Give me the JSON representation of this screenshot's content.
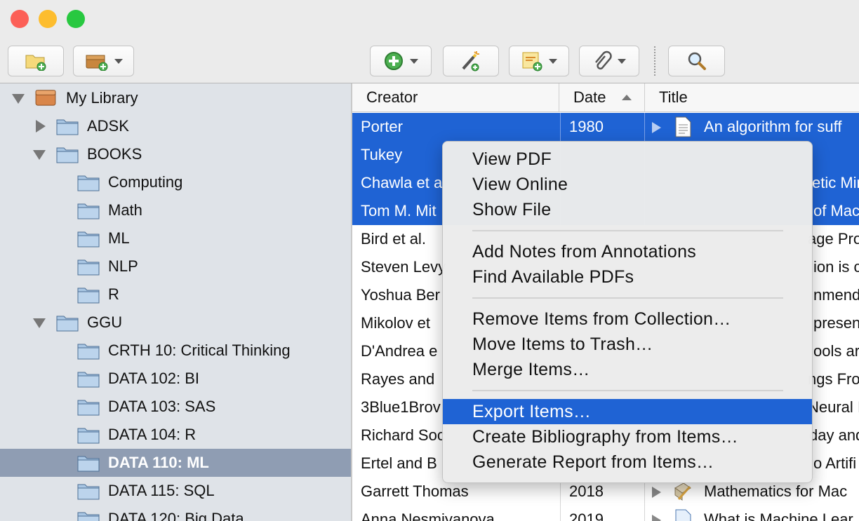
{
  "window": {
    "traffic_lights": {
      "close": "#fc5f57",
      "minimize": "#fdbd2e",
      "zoom": "#28c840"
    }
  },
  "toolbar": {
    "buttons": [
      {
        "icon": "new-collection-icon"
      },
      {
        "icon": "new-library-icon",
        "has_menu": true
      },
      {
        "icon": "new-item-icon",
        "has_menu": true
      },
      {
        "icon": "add-by-identifier-icon"
      },
      {
        "icon": "new-note-icon",
        "has_menu": true
      },
      {
        "icon": "add-attachment-icon",
        "has_menu": true
      },
      {
        "icon": "search-icon"
      }
    ]
  },
  "sidebar": {
    "items": [
      {
        "label": "My Library",
        "level": 0,
        "expanded": true,
        "type": "library"
      },
      {
        "label": "ADSK",
        "level": 1,
        "expanded": false
      },
      {
        "label": "BOOKS",
        "level": 1,
        "expanded": true
      },
      {
        "label": "Computing",
        "level": 2
      },
      {
        "label": "Math",
        "level": 2
      },
      {
        "label": "ML",
        "level": 2
      },
      {
        "label": "NLP",
        "level": 2
      },
      {
        "label": "R",
        "level": 2
      },
      {
        "label": "GGU",
        "level": 1,
        "expanded": true
      },
      {
        "label": "CRTH 10: Critical Thinking",
        "level": 2
      },
      {
        "label": "DATA 102: BI",
        "level": 2
      },
      {
        "label": "DATA 103: SAS",
        "level": 2
      },
      {
        "label": "DATA 104: R",
        "level": 2
      },
      {
        "label": "DATA 110: ML",
        "level": 2,
        "selected": true
      },
      {
        "label": "DATA 115: SQL",
        "level": 2
      },
      {
        "label": "DATA 120: Big Data",
        "level": 2
      }
    ]
  },
  "table": {
    "columns": {
      "creator": "Creator",
      "date": "Date",
      "title": "Title"
    },
    "sort": {
      "column": "date",
      "direction": "ascending"
    },
    "rows": [
      {
        "creator": "Porter",
        "date": "1980",
        "title": "An algorithm for suff",
        "selected": true,
        "icon": "document-icon"
      },
      {
        "creator": "Tukey",
        "date": "",
        "title": "",
        "selected": true
      },
      {
        "creator": "Chawla et a",
        "date": "",
        "title": "etic Mir",
        "selected": true
      },
      {
        "creator": "Tom M. Mit",
        "date": "",
        "title": "of Mac",
        "selected": true
      },
      {
        "creator": "Bird et al.",
        "date": "",
        "title": "age Pro",
        "selected": false
      },
      {
        "creator": "Steven Levy",
        "date": "",
        "title": "ion is c",
        "selected": false
      },
      {
        "creator": "Yoshua Ber",
        "date": "",
        "title": "nmend",
        "selected": false
      },
      {
        "creator": "Mikolov et",
        "date": "",
        "title": "presen",
        "selected": false
      },
      {
        "creator": "D'Andrea e",
        "date": "",
        "title": "ools ar",
        "selected": false
      },
      {
        "creator": "Rayes and",
        "date": "",
        "title": "ngs Fro",
        "selected": false
      },
      {
        "creator": "3Blue1Brov",
        "date": "",
        "title": "Neural I",
        "selected": false
      },
      {
        "creator": "Richard Soc",
        "date": "",
        "title": "day and",
        "selected": false
      },
      {
        "creator": "Ertel and B",
        "date": "",
        "title": "o Artifi",
        "selected": false
      },
      {
        "creator": "Garrett Thomas",
        "date": "2018",
        "title": "Mathematics for Mac",
        "selected": false,
        "icon": "book-pencil-icon"
      },
      {
        "creator": "Anna Nesmiyanova",
        "date": "2019",
        "title": "What is Machine Lear",
        "selected": false,
        "icon": "webpage-icon"
      }
    ]
  },
  "context_menu": {
    "groups": [
      [
        "View PDF",
        "View Online",
        "Show File"
      ],
      [
        "Add Notes from Annotations",
        "Find Available PDFs"
      ],
      [
        "Remove Items from Collection…",
        "Move Items to Trash…",
        "Merge Items…"
      ],
      [
        "Export Items…",
        "Create Bibliography from Items…",
        "Generate Report from Items…"
      ]
    ],
    "highlighted": "Export Items…"
  }
}
